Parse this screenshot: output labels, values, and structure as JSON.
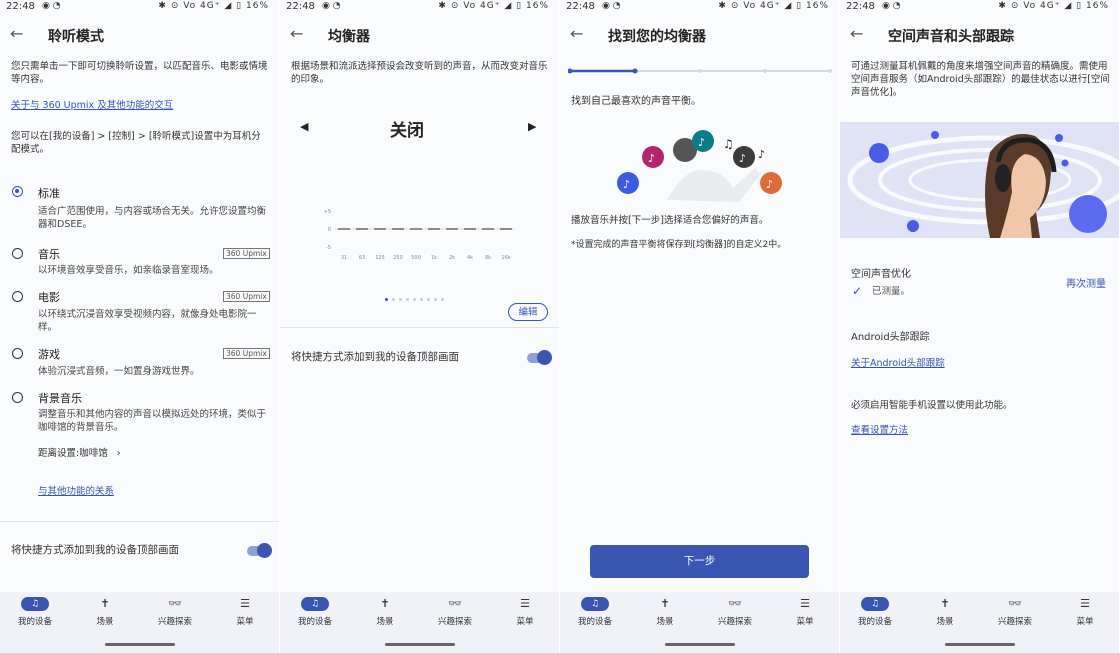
{
  "status": {
    "time": "22:48",
    "status_icons": "✱ ⊙ Vo 4G⁺ ◢ ▯",
    "battery": "16%"
  },
  "colors": {
    "accent": "#3a56b3",
    "link": "#3553b8"
  },
  "nav": [
    {
      "label": "我的设备",
      "icon": "headphones-icon"
    },
    {
      "label": "场景",
      "icon": "walking-icon"
    },
    {
      "label": "兴趣探索",
      "icon": "glasses-icon"
    },
    {
      "label": "菜单",
      "icon": "menu-icon"
    }
  ],
  "panel1": {
    "title": "聆听模式",
    "intro": "您只需单击一下即可切换聆听设置，以匹配音乐、电影或情境等内容。",
    "link_upmix": "关于与 360 Upmix 及其他功能的交互",
    "assign": "您可以在[我的设备] > [控制] > [聆听模式]设置中为耳机分配模式。",
    "options": [
      {
        "label": "标准",
        "desc": "适合广范围使用，与内容或场合无关。允许您设置均衡器和DSEE。",
        "badge": ""
      },
      {
        "label": "音乐",
        "desc": "以环境音效享受音乐，如亲临录音室现场。",
        "badge": "360 Upmix"
      },
      {
        "label": "电影",
        "desc": "以环绕式沉浸音效享受视频内容，就像身处电影院一样。",
        "badge": "360 Upmix"
      },
      {
        "label": "游戏",
        "desc": "体验沉浸式音频，一如置身游戏世界。",
        "badge": "360 Upmix"
      },
      {
        "label": "背景音乐",
        "desc": "调整音乐和其他内容的声音以模拟远处的环境，类似于咖啡馆的背景音乐。",
        "badge": ""
      }
    ],
    "distance": "距离设置:咖啡馆",
    "relation_link": "与其他功能的关系",
    "shortcut": "将快捷方式添加到我的设备顶部画面"
  },
  "panel2": {
    "title": "均衡器",
    "desc": "根据场景和流派选择预设会改变听到的声音，从而改变对音乐的印象。",
    "preset": "关闭",
    "prev": "◀",
    "next": "▶",
    "eq_bands": [
      "31",
      "63",
      "125",
      "250",
      "500",
      "1k",
      "2k",
      "4k",
      "8k",
      "16k"
    ],
    "eq_levels": [
      0,
      0,
      0,
      0,
      0,
      0,
      0,
      0,
      0,
      0
    ],
    "eq_yticks": [
      "+5",
      "0",
      "-5"
    ],
    "page_index": 1,
    "page_count": 9,
    "edit": "编辑",
    "shortcut": "将快捷方式添加到我的设备顶部画面"
  },
  "panel3": {
    "title": "找到您的均衡器",
    "progress": 0.25,
    "heading": "找到自己最喜欢的声音平衡。",
    "instr": "播放音乐并按[下一步]选择适合您偏好的声音。",
    "note": "*设置完成的声音平衡将保存到[均衡器]的自定义2中。",
    "next": "下一步"
  },
  "panel4": {
    "title": "空间声音和头部跟踪",
    "desc": "可通过测量耳机佩戴的角度来增强空间声音的精确度。需使用空间声音服务（如Android头部跟踪）的最佳状态以进行[空间声音优化]。",
    "opt_title": "空间声音优化",
    "measured": "已测量。",
    "remeasure": "再次测量",
    "ht_title": "Android头部跟踪",
    "ht_link": "关于Android头部跟踪",
    "enable_text": "必须启用智能手机设置以使用此功能。",
    "setup_link": "查看设置方法"
  }
}
